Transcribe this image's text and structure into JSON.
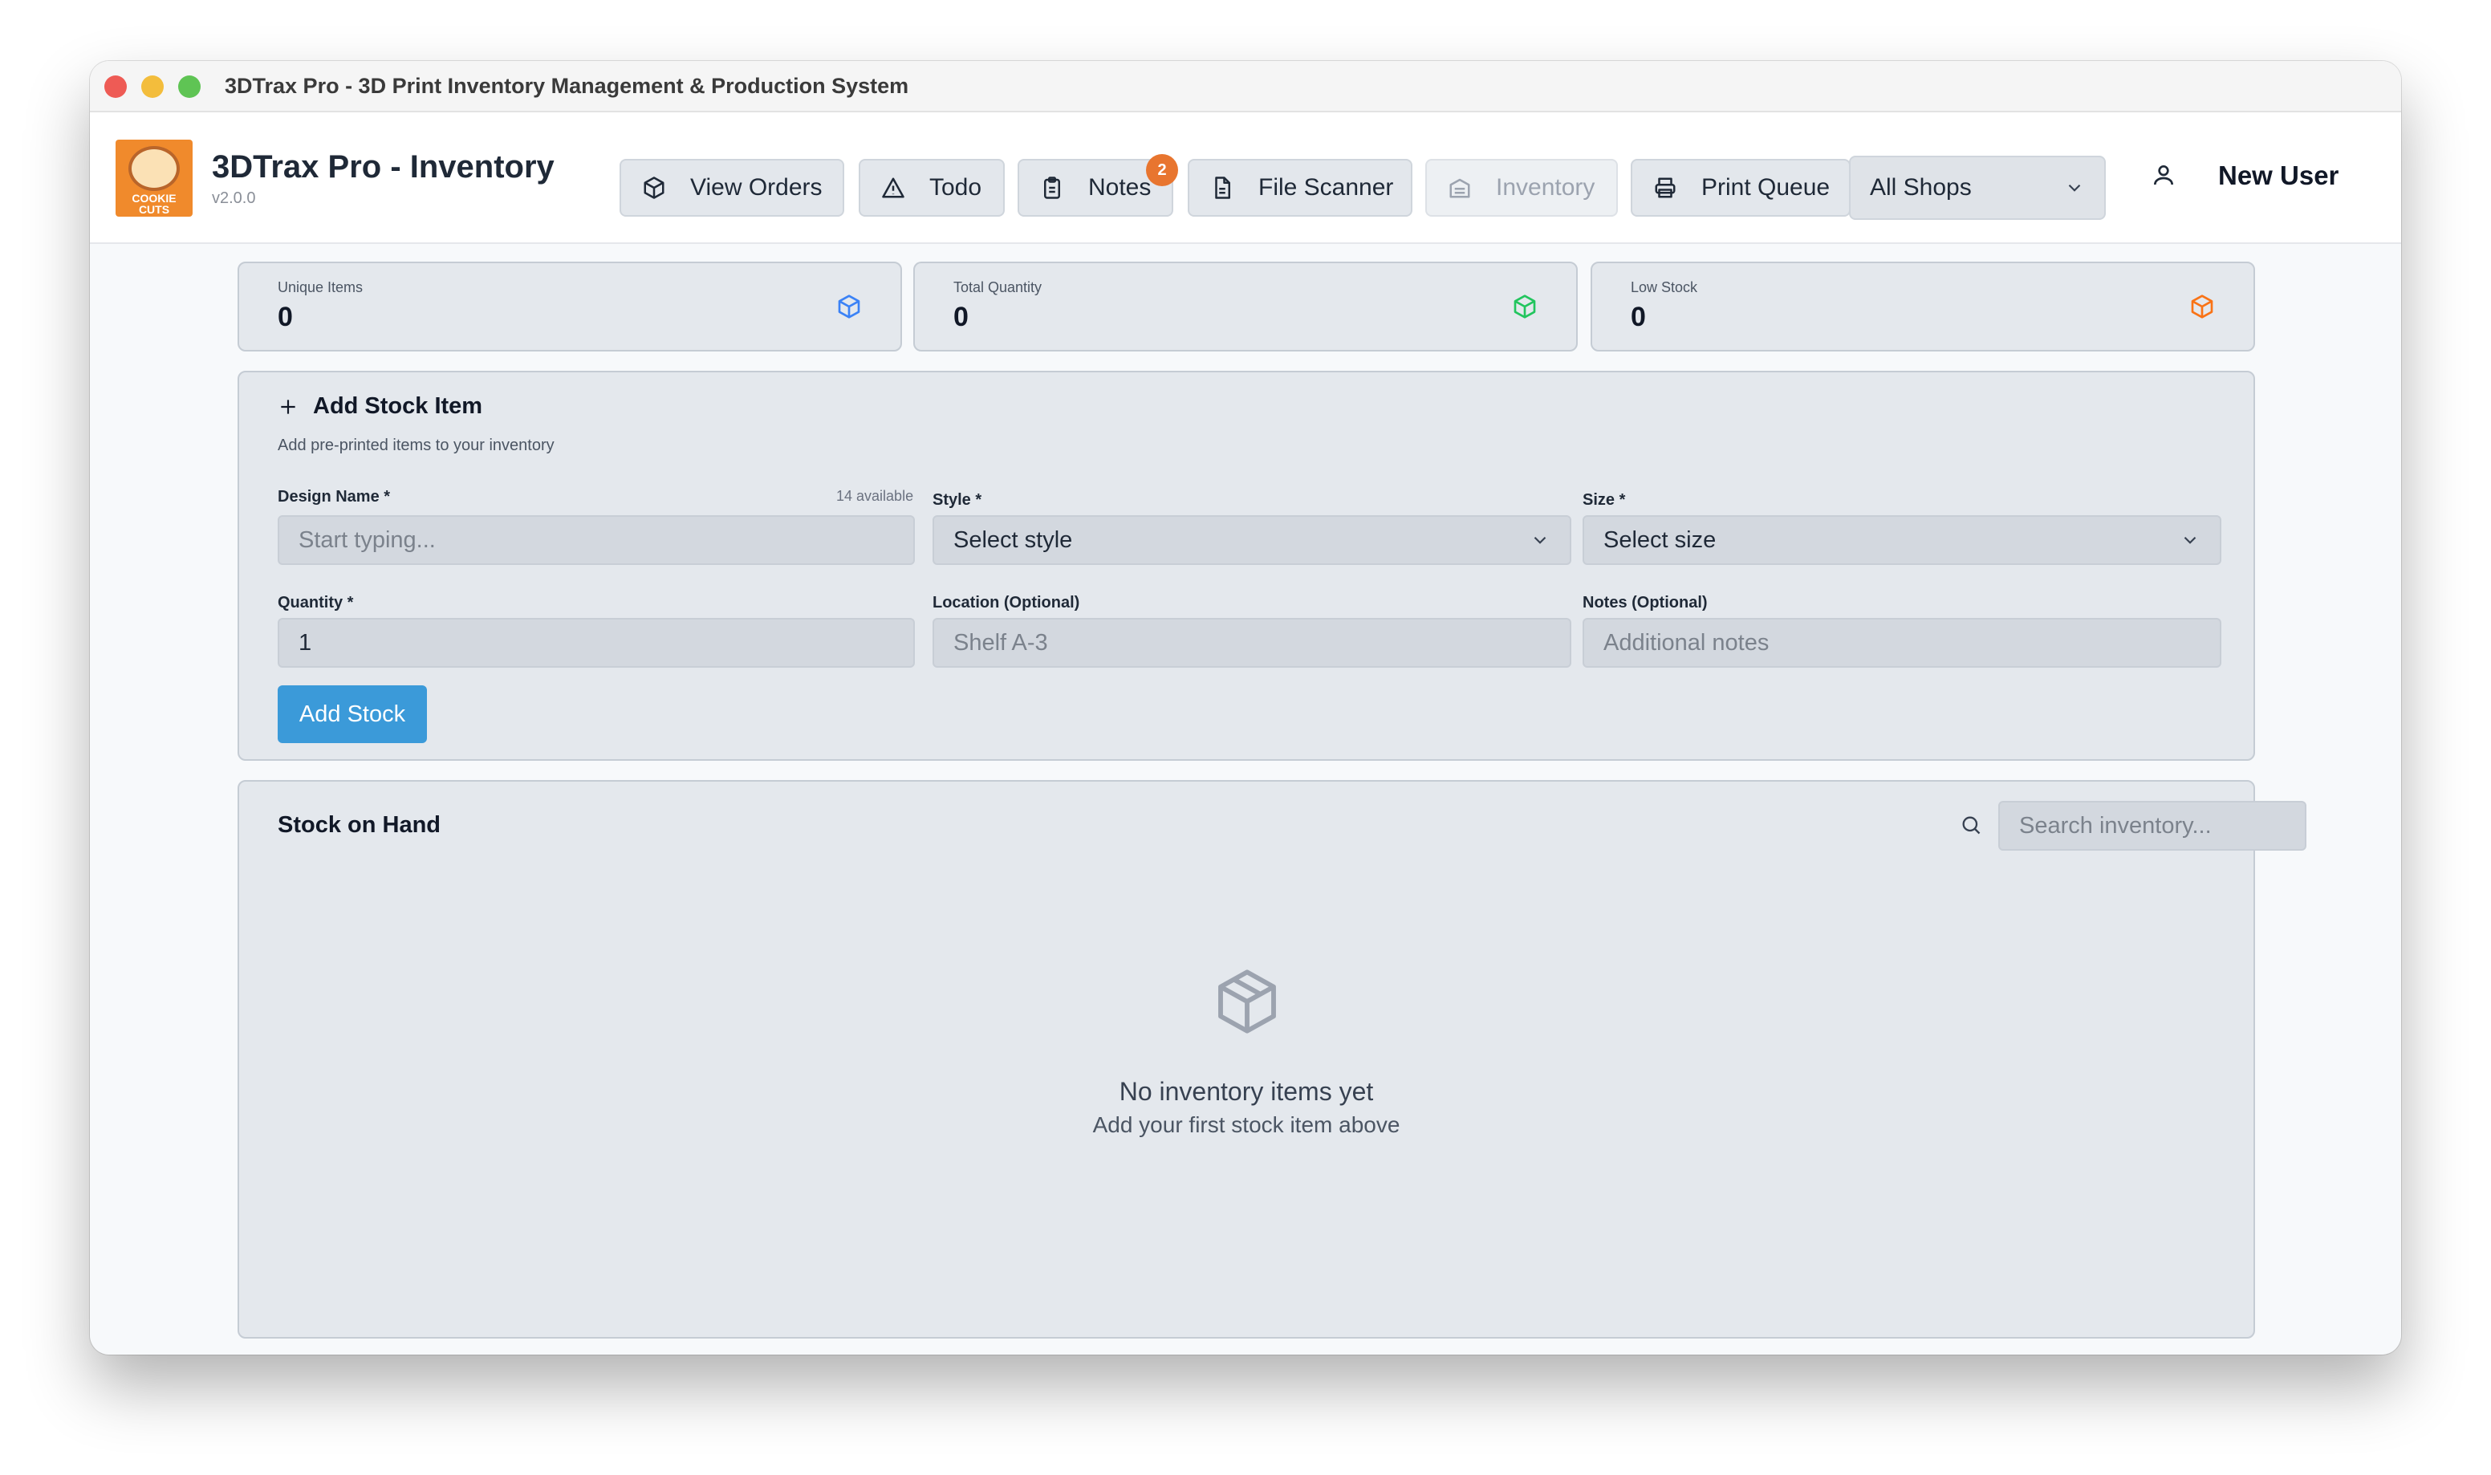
{
  "window": {
    "title": "3DTrax Pro - 3D Print Inventory Management & Production System"
  },
  "header": {
    "logo_lines": [
      "COOKIE",
      "CUTS"
    ],
    "app_title": "3DTrax Pro - Inventory",
    "version": "v2.0.0",
    "nav": {
      "view_orders": "View Orders",
      "todo": "Todo",
      "notes": "Notes",
      "notes_badge": "2",
      "file_scanner": "File Scanner",
      "inventory": "Inventory",
      "print_queue": "Print Queue"
    },
    "shop_select": {
      "value": "All Shops"
    },
    "user": {
      "name": "New User"
    }
  },
  "stats": [
    {
      "label": "Unique Items",
      "value": "0",
      "icon": "cube-icon",
      "color": "#3b82f6"
    },
    {
      "label": "Total Quantity",
      "value": "0",
      "icon": "cube-icon",
      "color": "#22c55e"
    },
    {
      "label": "Low Stock",
      "value": "0",
      "icon": "cube-icon",
      "color": "#f97316"
    }
  ],
  "add_stock": {
    "title": "Add Stock Item",
    "subtitle": "Add pre-printed items to your inventory",
    "design_name": {
      "label": "Design Name *",
      "hint": "14 available",
      "placeholder": "Start typing..."
    },
    "style": {
      "label": "Style *",
      "value": "Select style"
    },
    "size": {
      "label": "Size *",
      "value": "Select size"
    },
    "quantity": {
      "label": "Quantity *",
      "value": "1"
    },
    "location": {
      "label": "Location (Optional)",
      "placeholder": "Shelf A-3"
    },
    "notes": {
      "label": "Notes (Optional)",
      "placeholder": "Additional notes"
    },
    "submit": "Add Stock"
  },
  "stock_on_hand": {
    "title": "Stock on Hand",
    "search_placeholder": "Search inventory...",
    "empty_title": "No inventory items yet",
    "empty_subtitle": "Add your first stock item above"
  },
  "colors": {
    "accent": "#3b9ad9",
    "badge": "#e8752f",
    "logo_bg": "#f08a2c"
  }
}
